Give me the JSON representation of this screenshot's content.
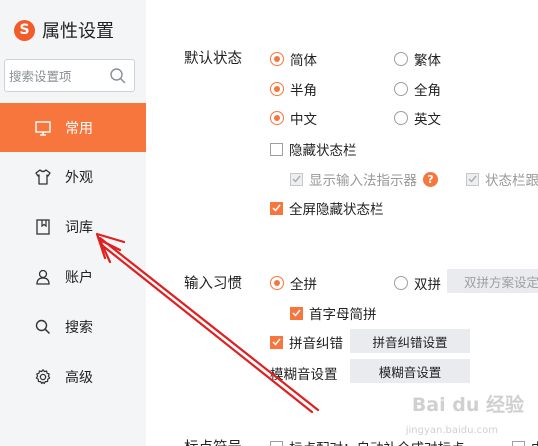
{
  "app": {
    "logo_letter": "S",
    "title": "属性设置"
  },
  "search": {
    "placeholder": "搜索设置项"
  },
  "sidebar": {
    "items": [
      {
        "label": "常用",
        "icon": "monitor-icon",
        "active": true
      },
      {
        "label": "外观",
        "icon": "shirt-icon",
        "active": false
      },
      {
        "label": "词库",
        "icon": "dictionary-icon",
        "active": false
      },
      {
        "label": "账户",
        "icon": "user-icon",
        "active": false
      },
      {
        "label": "搜索",
        "icon": "search-icon",
        "active": false
      },
      {
        "label": "高级",
        "icon": "gear-icon",
        "active": false
      }
    ]
  },
  "default_state": {
    "title": "默认状态",
    "simplified": "简体",
    "traditional": "繁体",
    "half_width": "半角",
    "full_width": "全角",
    "chinese": "中文",
    "english": "英文",
    "hide_status_bar": "隐藏状态栏",
    "show_ime_indicator": "显示输入法指示器",
    "status_bar_partial": "状态栏跟",
    "fullscreen_hide": "全屏隐藏状态栏",
    "help_symbol": "?"
  },
  "input_habit": {
    "title": "输入习惯",
    "full_pinyin": "全拼",
    "double_pinyin": "双拼",
    "double_scheme_btn": "双拼方案设定",
    "initial_abbrev": "首字母简拼",
    "pinyin_correction": "拼音纠错",
    "pinyin_correction_btn": "拼音纠错设置",
    "fuzzy_label": "模糊音设置",
    "fuzzy_btn": "模糊音设置"
  },
  "punctuation": {
    "title": "标点符号",
    "auto_pair": "标点配对：自动补全成对标点",
    "partial": "中"
  },
  "watermark": {
    "main": "Bai du 经验",
    "sub": "jingyan.baidu.com"
  },
  "colors": {
    "accent": "#f7763e",
    "sidebar_bg": "#f4f5f7",
    "annotation_red": "#e02020"
  }
}
